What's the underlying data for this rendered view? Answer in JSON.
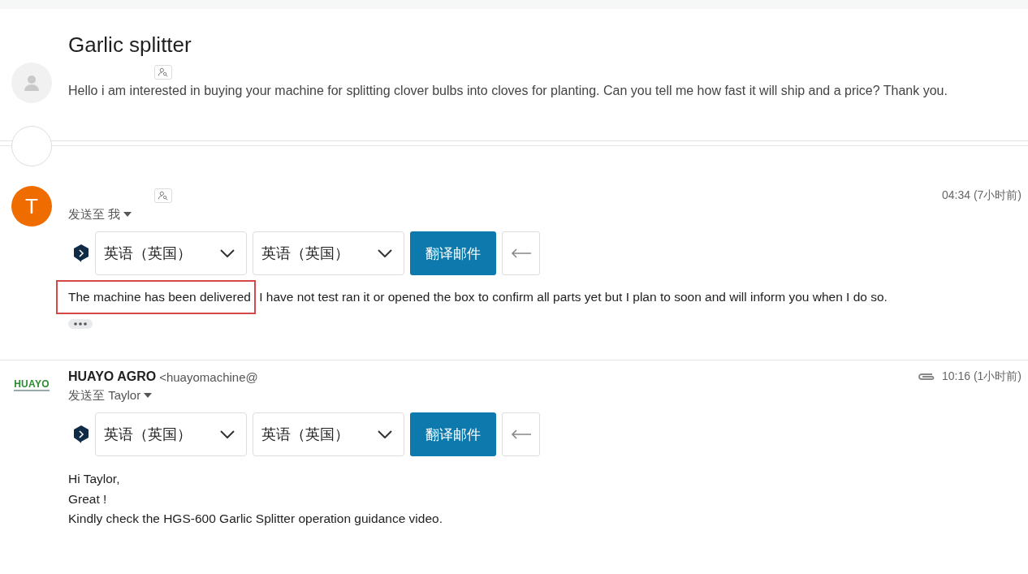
{
  "title": "Garlic splitter",
  "messages": [
    {
      "kind": "snippet",
      "avatar": {
        "kind": "placeholder"
      },
      "contact_icon": true,
      "snippet": "Hello i am interested in buying your machine for splitting clover bulbs into cloves for planting. Can you tell me how fast it will ship and a price? Thank you."
    },
    {
      "kind": "collapsed"
    },
    {
      "kind": "full",
      "avatar": {
        "kind": "letter",
        "letter": "T",
        "color": "#ef6c00"
      },
      "contact_icon": true,
      "attachment": false,
      "time": "04:34 (7小时前)",
      "recipient": "发送至 我",
      "translate": {
        "source": "英语（英国）",
        "target": "英语（英国）",
        "button": "翻译邮件"
      },
      "body": [
        {
          "parts": [
            {
              "text": "The machine has been delivered",
              "highlighted": true
            },
            {
              "text": " I have not test ran it or opened the box to confirm all parts yet but I plan to soon and will inform you when I do so.",
              "highlighted": false
            }
          ]
        }
      ],
      "trimmed": true
    },
    {
      "kind": "full",
      "avatar": {
        "kind": "logo",
        "text": "HUAYO"
      },
      "contact_icon": false,
      "sender": "HUAYO AGRO",
      "address": "<huayomachine@",
      "attachment": true,
      "time": "10:16 (1小时前)",
      "recipient": "发送至 Taylor",
      "translate": {
        "source": "英语（英国）",
        "target": "英语（英国）",
        "button": "翻译邮件"
      },
      "body": [
        {
          "parts": [
            {
              "text": "Hi Taylor,",
              "highlighted": false
            }
          ]
        },
        {
          "parts": [
            {
              "text": "Great !",
              "highlighted": false
            }
          ]
        },
        {
          "parts": [
            {
              "text": "Kindly check the HGS-600 Garlic Splitter operation guidance video.",
              "highlighted": false
            }
          ]
        }
      ],
      "trimmed": false
    }
  ]
}
